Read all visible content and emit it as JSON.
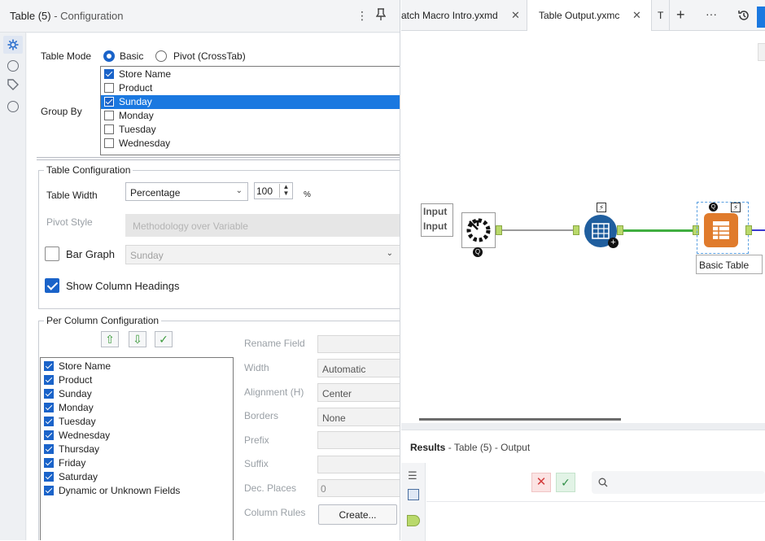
{
  "config_panel": {
    "title": "Table (5)",
    "subtitle": "- Configuration",
    "menu_icon": "more-vertical-icon",
    "pin_icon": "pin-icon",
    "side_icons": [
      "gear-icon",
      "connection-icon",
      "tag-icon",
      "help-icon"
    ],
    "table_mode": {
      "label": "Table Mode",
      "options": [
        "Basic",
        "Pivot (CrossTab)"
      ],
      "selected": "Basic"
    },
    "group_by": {
      "label": "Group By",
      "items": [
        {
          "label": "Store Name",
          "checked": true,
          "selected": false
        },
        {
          "label": "Product",
          "checked": false,
          "selected": false
        },
        {
          "label": "Sunday",
          "checked": true,
          "selected": true
        },
        {
          "label": "Monday",
          "checked": false,
          "selected": false
        },
        {
          "label": "Tuesday",
          "checked": false,
          "selected": false
        },
        {
          "label": "Wednesday",
          "checked": false,
          "selected": false
        }
      ]
    },
    "table_configuration": {
      "title": "Table Configuration",
      "table_width_label": "Table Width",
      "table_width_value": "Percentage",
      "width_number": "100",
      "width_unit": "%",
      "pivot_style_label": "Pivot Style",
      "pivot_style_value": "Methodology over Variable",
      "bar_graph_label": "Bar Graph",
      "bar_graph_checked": false,
      "bar_graph_value": "Sunday",
      "show_headings_label": "Show Column Headings",
      "show_headings_checked": true
    },
    "per_column": {
      "title": "Per Column Configuration",
      "fields": [
        {
          "label": "Store Name",
          "checked": true
        },
        {
          "label": "Product",
          "checked": true
        },
        {
          "label": "Sunday",
          "checked": true
        },
        {
          "label": "Monday",
          "checked": true
        },
        {
          "label": "Tuesday",
          "checked": true
        },
        {
          "label": "Wednesday",
          "checked": true
        },
        {
          "label": "Thursday",
          "checked": true
        },
        {
          "label": "Friday",
          "checked": true
        },
        {
          "label": "Saturday",
          "checked": true
        },
        {
          "label": "Dynamic or Unknown Fields",
          "checked": true
        }
      ],
      "rename_field_label": "Rename Field",
      "width_label": "Width",
      "width_value": "Automatic",
      "alignment_label": "Alignment (H)",
      "alignment_value": "Center",
      "borders_label": "Borders",
      "borders_value": "None",
      "prefix_label": "Prefix",
      "suffix_label": "Suffix",
      "dec_places_label": "Dec. Places",
      "dec_places_value": "0",
      "column_rules_label": "Column Rules",
      "create_button": "Create..."
    }
  },
  "tabs": {
    "items": [
      {
        "label": "atch Macro Intro.yxmd",
        "active": false
      },
      {
        "label": "Table Output.yxmc",
        "active": true
      },
      {
        "label": "T",
        "active": false
      }
    ],
    "add_icon": "plus-icon",
    "more_icon": "more-horizontal-icon",
    "history_icon": "history-icon"
  },
  "canvas": {
    "input_box_lines": [
      "Input",
      "Input"
    ],
    "table_node_label": "Basic Table"
  },
  "results": {
    "title": "Results",
    "subtitle": "- Table (5) - Output",
    "search_icon": "search-icon"
  },
  "colors": {
    "accent": "#1a63c9",
    "selection": "#1a78e0",
    "connector_green": "#3fae3f",
    "anchor_green": "#b9d96b",
    "node_blue": "#1f5e9e",
    "node_orange": "#e07b2c"
  }
}
